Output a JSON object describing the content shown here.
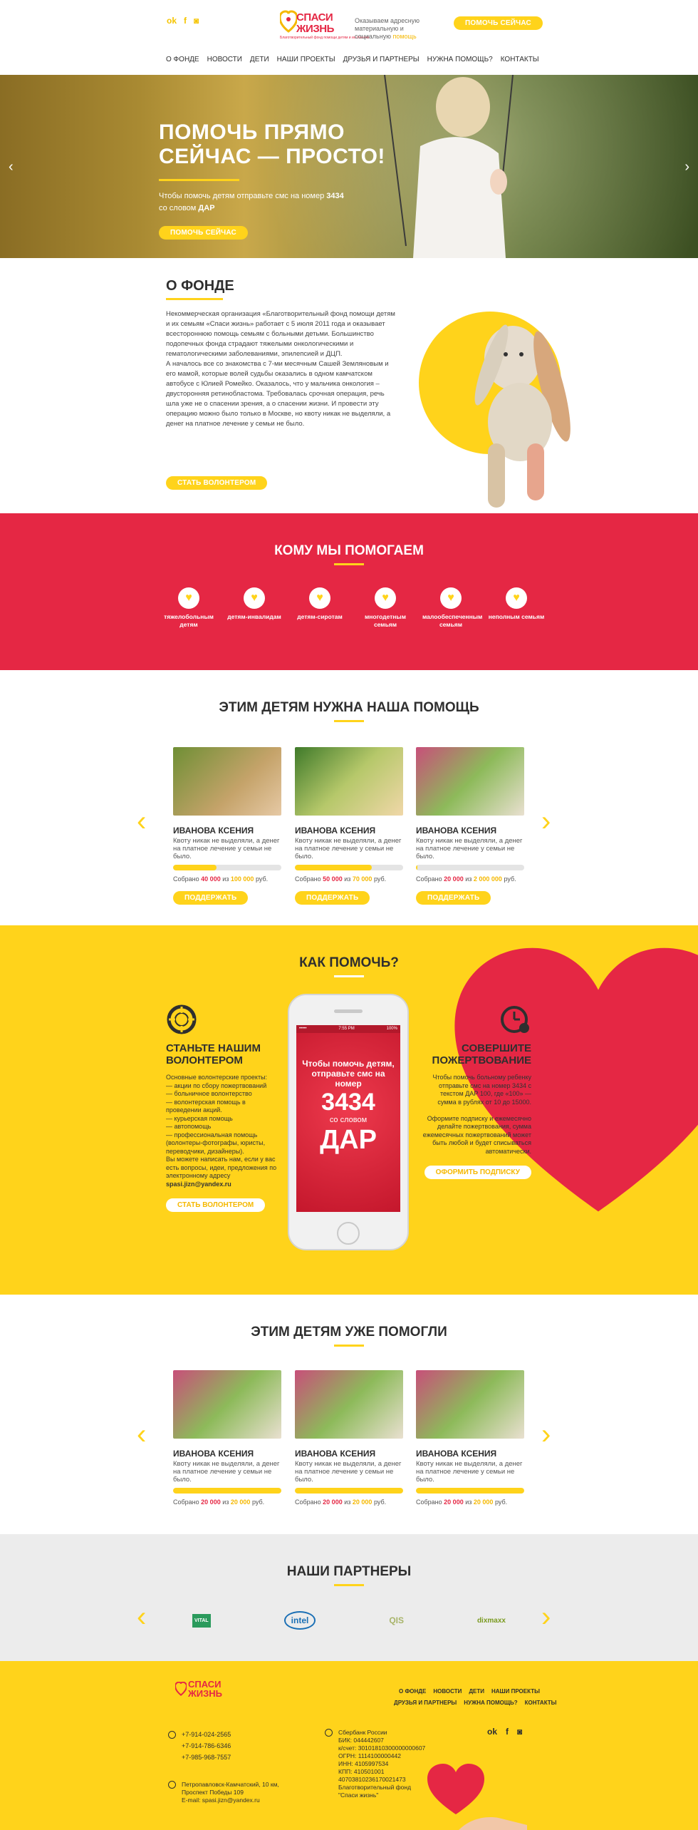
{
  "header": {
    "social": [
      "ok-icon",
      "facebook-icon",
      "instagram-icon"
    ],
    "logo_line1": "СПАСИ",
    "logo_line2": "ЖИЗНЬ",
    "logo_sub": "Благотворительный фонд помощи детям и их семьям",
    "tagline_pre": "Оказываем адресную материальную и социальную",
    "tagline_accent": "помощь",
    "help_button": "Помочь сейчас",
    "nav": [
      "О фонде",
      "Новости",
      "Дети",
      "Наши проекты",
      "Друзья и партнеры",
      "Нужна помощь?",
      "Контакты"
    ]
  },
  "hero": {
    "title": "Помочь прямо сейчас — просто!",
    "text_pre": "Чтобы помочь детям отправьте смс на номер ",
    "number": "3434",
    "text_mid": " со словом ",
    "word": "ДАР",
    "button": "Помочь сейчас"
  },
  "about": {
    "title": "О фонде",
    "text": "Некоммерческая организация «Благотворительный фонд помощи детям и их семьям «Спаси жизнь» работает с 5 июля 2011 года и оказывает всестороннюю помощь семьям с больными детьми. Большинство подопечных фонда страдают тяжелыми онкологическими и гематологическими заболеваниями, эпилепсией и ДЦП.\nА началось все со знакомства с 7-ми месячным Сашей Земляновым и его мамой, которые волей судьбы оказались в одном камчатском автобусе с Юлией Ромейко. Оказалось, что у мальчика онкология – двусторонняя ретинобластома. Требовалась срочная операция, речь шла уже не о спасении зрения, а о спасении жизни. И провести эту операцию можно было только в Москве, но квоту никак не выделяли, а денег на платное лечение у семьи не было.",
    "button": "Стать волонтером"
  },
  "whom": {
    "title": "Кому мы помогаем",
    "items": [
      {
        "label": "тяжелобольным детям"
      },
      {
        "label": "детям-инвалидам"
      },
      {
        "label": "детям-сиротам"
      },
      {
        "label": "многодетным семьям"
      },
      {
        "label": "малообеспеченным семьям"
      },
      {
        "label": "неполным семьям"
      }
    ]
  },
  "need_help": {
    "title": "Этим детям нужна наша помощь",
    "cards": [
      {
        "name": "Иванова Ксения",
        "desc": "Квоту никак не выделяли, а денег на платное лечение у семьи не было.",
        "pre": "Собрано",
        "collected": "40 000",
        "of": "из",
        "goal": "100 000",
        "unit": "руб.",
        "progress": 0.4,
        "button": "Поддержать"
      },
      {
        "name": "Иванова Ксения",
        "desc": "Квоту никак не выделяли, а денег на платное лечение у семьи не было.",
        "pre": "Собрано",
        "collected": "50 000",
        "of": "из",
        "goal": "70 000",
        "unit": "руб.",
        "progress": 0.71,
        "button": "Поддержать"
      },
      {
        "name": "Иванова Ксения",
        "desc": "Квоту никак не выделяли, а денег на платное лечение у семьи не было.",
        "pre": "Собрано",
        "collected": "20 000",
        "of": "из",
        "goal": "2 000 000",
        "unit": "руб.",
        "progress": 0.01,
        "button": "Поддержать"
      }
    ]
  },
  "how": {
    "title": "Как помочь?",
    "left_title": "Станьте нашим волонтером",
    "left_text": "Основные волонтерские проекты:\n— акции по сбору пожертвований\n— больничное волонтерство\n— волонтерская помощь в проведении акций.\n— курьерская помощь\n— автопомощь\n— профессиональная помощь (волонтеры-фотографы, юристы, переводчики, дизайнеры).\nВы можете написать нам, если у вас есть вопросы, идеи, предложения по электронному адресу",
    "left_email": "spasi.jizn@yandex.ru",
    "left_button": "Стать волонтером",
    "phone_time": "7:55 PM",
    "phone_battery": "100%",
    "phone_l1": "Чтобы помочь детям, отправьте смс на номер",
    "phone_number": "3434",
    "phone_l2": "со словом",
    "phone_word": "ДАР",
    "right_title": "Совершите пожертвование",
    "right_text": "Чтобы помочь больному ребенку отправьте смс на номер 3434 с текстом ДАР 100, где «100» — сумма в рублях от 10 до 15000.\n\nОформите подписку и ежемесячно делайте пожертвования, сумма ежемесячных пожертвований может быть любой и будет списываться автоматически.",
    "right_button": "Оформить подписку"
  },
  "helped": {
    "title": "Этим детям уже помогли",
    "cards": [
      {
        "name": "Иванова Ксения",
        "desc": "Квоту никак не выделяли, а денег на платное лечение у семьи не было.",
        "pre": "Собрано",
        "collected": "20 000",
        "of": "из",
        "goal": "20 000",
        "unit": "руб.",
        "progress": 1
      },
      {
        "name": "Иванова Ксения",
        "desc": "Квоту никак не выделяли, а денег на платное лечение у семьи не было.",
        "pre": "Собрано",
        "collected": "20 000",
        "of": "из",
        "goal": "20 000",
        "unit": "руб.",
        "progress": 1
      },
      {
        "name": "Иванова Ксения",
        "desc": "Квоту никак не выделяли, а денег на платное лечение у семьи не было.",
        "pre": "Собрано",
        "collected": "20 000",
        "of": "из",
        "goal": "20 000",
        "unit": "руб.",
        "progress": 1
      }
    ]
  },
  "partners": {
    "title": "Наши партнеры",
    "logos": [
      "VITAL",
      "intel",
      "QIS",
      "dixmaxx"
    ]
  },
  "footer": {
    "logo_line1": "СПАСИ",
    "logo_line2": "ЖИЗНЬ",
    "nav1": [
      "О фонде",
      "Новости",
      "Дети",
      "Наши проекты"
    ],
    "nav2": [
      "Друзья и партнеры",
      "Нужна помощь?",
      "Контакты"
    ],
    "phones": [
      "+7-914-024-2565",
      "+7-914-786-6346",
      "+7-985-968-7557"
    ],
    "address": "Петропавловск-Камчатский, 10 км,\nПроспект Победы 109\nE-mail: spasi.jizn@yandex.ru",
    "bank": "Сбербанк России\nБИК: 044442607\nк/счет: 30101810300000000607\nОГРН: 1114100000442\nИНН: 4105997534\nКПП: 410501001\n40703810236170021473\nБлаготворительный фонд\n\"Спаси жизнь\""
  }
}
